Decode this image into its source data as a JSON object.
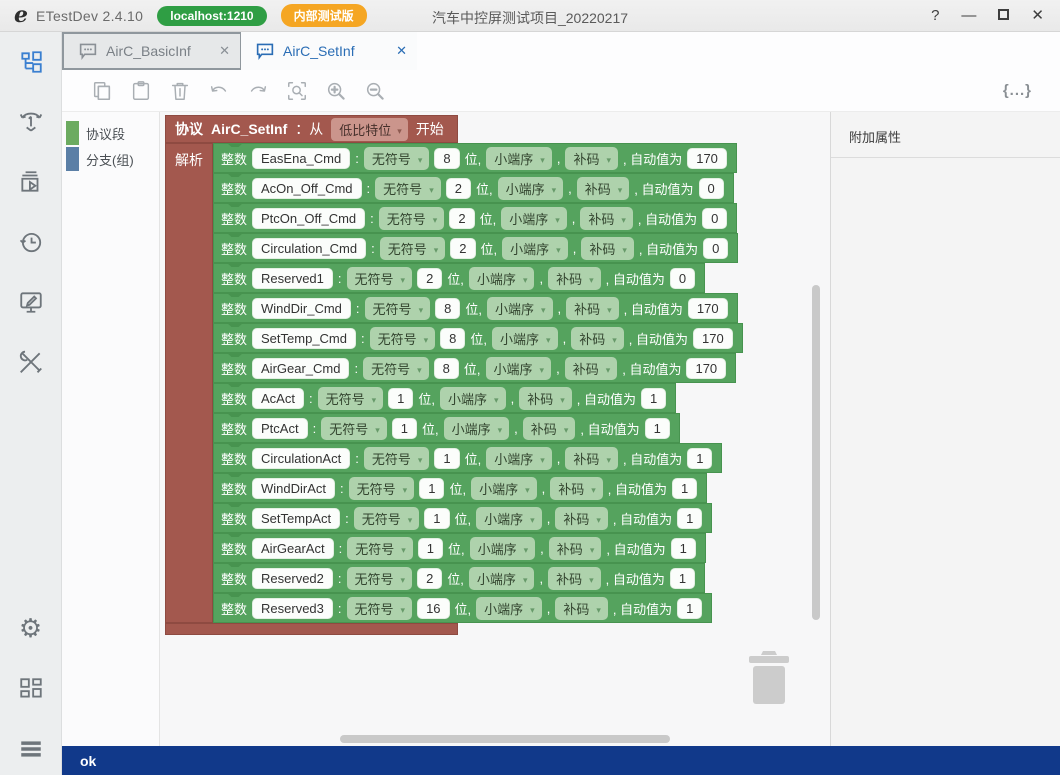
{
  "window": {
    "logo_glyph": "e",
    "app_title": "ETestDev 2.4.10",
    "host_badge": "localhost:1210",
    "build_badge": "内部测试版",
    "document_title": "汽车中控屏测试项目_20220217",
    "controls": {
      "help": "?",
      "minimize": "—",
      "close": "✕"
    }
  },
  "tabs": [
    {
      "label": "AirC_BasicInf",
      "close": "✕",
      "active": false
    },
    {
      "label": "AirC_SetInf",
      "close": "✕",
      "active": true
    }
  ],
  "toolbar": {
    "icons": [
      "copy-icon",
      "paste-icon",
      "delete-icon",
      "undo-icon",
      "redo-icon",
      "zoom-fit-icon",
      "zoom-in-icon",
      "zoom-out-icon"
    ],
    "braces_icon": "{...}"
  },
  "sidebar": {
    "icons": [
      "protocol-tree-icon",
      "touch-gesture-icon",
      "run-layers-icon",
      "history-icon",
      "monitor-edit-icon",
      "tools-icon",
      "settings-gear-icon",
      "dashboard-grid-icon",
      "menu-icon"
    ],
    "gear_glyph": "⚙"
  },
  "toolbox": {
    "items": [
      {
        "label": "协议段",
        "color": "#6cab60"
      },
      {
        "label": "分支(组)",
        "color": "#5b7fa6"
      }
    ]
  },
  "block": {
    "keyword": "协议",
    "name": "AirC_SetInf",
    "from_label": "：从",
    "bit_order_value": "低比特位",
    "start_label": "开始",
    "parse_label": "解析",
    "row_labels": {
      "type": "整数",
      "colon": ":",
      "bits_suffix": "位,",
      "comma": ",",
      "auto_label": ", 自动值为"
    },
    "fields": [
      {
        "name": "EasEna_Cmd",
        "sign": "无符号",
        "bits": "8",
        "endian": "小端序",
        "code": "补码",
        "value": "170"
      },
      {
        "name": "AcOn_Off_Cmd",
        "sign": "无符号",
        "bits": "2",
        "endian": "小端序",
        "code": "补码",
        "value": "0"
      },
      {
        "name": "PtcOn_Off_Cmd",
        "sign": "无符号",
        "bits": "2",
        "endian": "小端序",
        "code": "补码",
        "value": "0"
      },
      {
        "name": "Circulation_Cmd",
        "sign": "无符号",
        "bits": "2",
        "endian": "小端序",
        "code": "补码",
        "value": "0"
      },
      {
        "name": "Reserved1",
        "sign": "无符号",
        "bits": "2",
        "endian": "小端序",
        "code": "补码",
        "value": "0"
      },
      {
        "name": "WindDir_Cmd",
        "sign": "无符号",
        "bits": "8",
        "endian": "小端序",
        "code": "补码",
        "value": "170"
      },
      {
        "name": "SetTemp_Cmd",
        "sign": "无符号",
        "bits": "8",
        "endian": "小端序",
        "code": "补码",
        "value": "170"
      },
      {
        "name": "AirGear_Cmd",
        "sign": "无符号",
        "bits": "8",
        "endian": "小端序",
        "code": "补码",
        "value": "170"
      },
      {
        "name": "AcAct",
        "sign": "无符号",
        "bits": "1",
        "endian": "小端序",
        "code": "补码",
        "value": "1"
      },
      {
        "name": "PtcAct",
        "sign": "无符号",
        "bits": "1",
        "endian": "小端序",
        "code": "补码",
        "value": "1"
      },
      {
        "name": "CirculationAct",
        "sign": "无符号",
        "bits": "1",
        "endian": "小端序",
        "code": "补码",
        "value": "1"
      },
      {
        "name": "WindDirAct",
        "sign": "无符号",
        "bits": "1",
        "endian": "小端序",
        "code": "补码",
        "value": "1"
      },
      {
        "name": "SetTempAct",
        "sign": "无符号",
        "bits": "1",
        "endian": "小端序",
        "code": "补码",
        "value": "1"
      },
      {
        "name": "AirGearAct",
        "sign": "无符号",
        "bits": "1",
        "endian": "小端序",
        "code": "补码",
        "value": "1"
      },
      {
        "name": "Reserved2",
        "sign": "无符号",
        "bits": "2",
        "endian": "小端序",
        "code": "补码",
        "value": "1"
      },
      {
        "name": "Reserved3",
        "sign": "无符号",
        "bits": "16",
        "endian": "小端序",
        "code": "补码",
        "value": "1"
      }
    ]
  },
  "right_panel": {
    "title": "附加属性"
  },
  "status_bar": {
    "text": "ok"
  },
  "colors": {
    "block_green": "#55a35e",
    "block_green_light": "#aed2ac",
    "block_maroon": "#a3584e",
    "block_maroon_light": "#cb958c",
    "accent_blue": "#2a6db5",
    "badge_green": "#2f9e44",
    "badge_orange": "#f5a623",
    "status_bar_blue": "#11398a"
  }
}
